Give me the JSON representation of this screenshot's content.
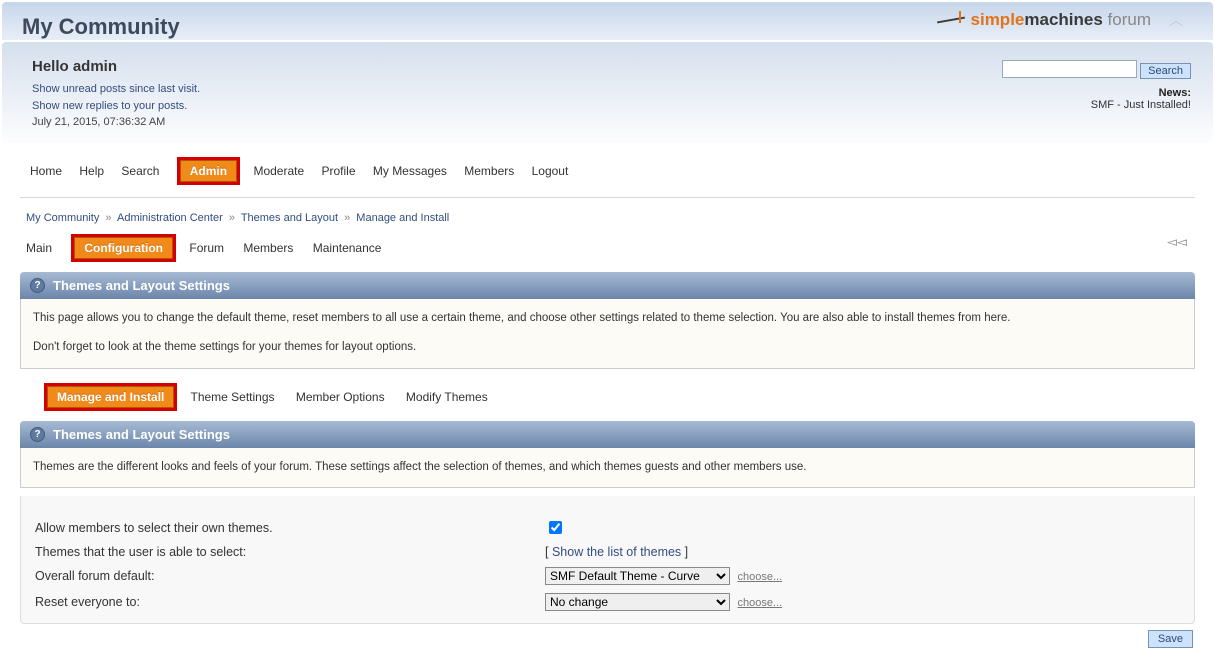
{
  "site_title": "My Community",
  "logo": {
    "orange": "simple",
    "dark": "machines",
    "light": " forum"
  },
  "user_panel": {
    "greeting": "Hello admin",
    "unread_link": "Show unread posts since last visit.",
    "replies_link": "Show new replies to your posts.",
    "datetime": "July 21, 2015, 07:36:32 AM",
    "search_btn": "Search",
    "news_label": "News:",
    "news_text": "SMF - Just Installed!"
  },
  "main_menu": {
    "home": "Home",
    "help": "Help",
    "search": "Search",
    "admin": "Admin",
    "moderate": "Moderate",
    "profile": "Profile",
    "messages": "My Messages",
    "members": "Members",
    "logout": "Logout"
  },
  "breadcrumb": {
    "a": "My Community",
    "b": "Administration Center",
    "c": "Themes and Layout",
    "d": "Manage and Install"
  },
  "admin_menu": {
    "main": "Main",
    "config": "Configuration",
    "forum": "Forum",
    "members": "Members",
    "maintenance": "Maintenance"
  },
  "section1_title": "Themes and Layout Settings",
  "info1_a": "This page allows you to change the default theme, reset members to all use a certain theme, and choose other settings related to theme selection. You are also able to install themes from here.",
  "info1_b": "Don't forget to look at the theme settings for your themes for layout options.",
  "tabs": {
    "manage": "Manage and Install",
    "theme_settings": "Theme Settings",
    "member_options": "Member Options",
    "modify": "Modify Themes"
  },
  "section2_title": "Themes and Layout Settings",
  "info2": "Themes are the different looks and feels of your forum. These settings affect the selection of themes, and which themes guests and other members use.",
  "settings": {
    "allow_select_label": "Allow members to select their own themes.",
    "themes_user_label": "Themes that the user is able to select:",
    "show_list_link": "Show the list of themes",
    "overall_default_label": "Overall forum default:",
    "default_theme_value": "SMF Default Theme - Curve",
    "reset_label": "Reset everyone to:",
    "reset_value": "No change",
    "choose": "choose...",
    "save": "Save"
  }
}
